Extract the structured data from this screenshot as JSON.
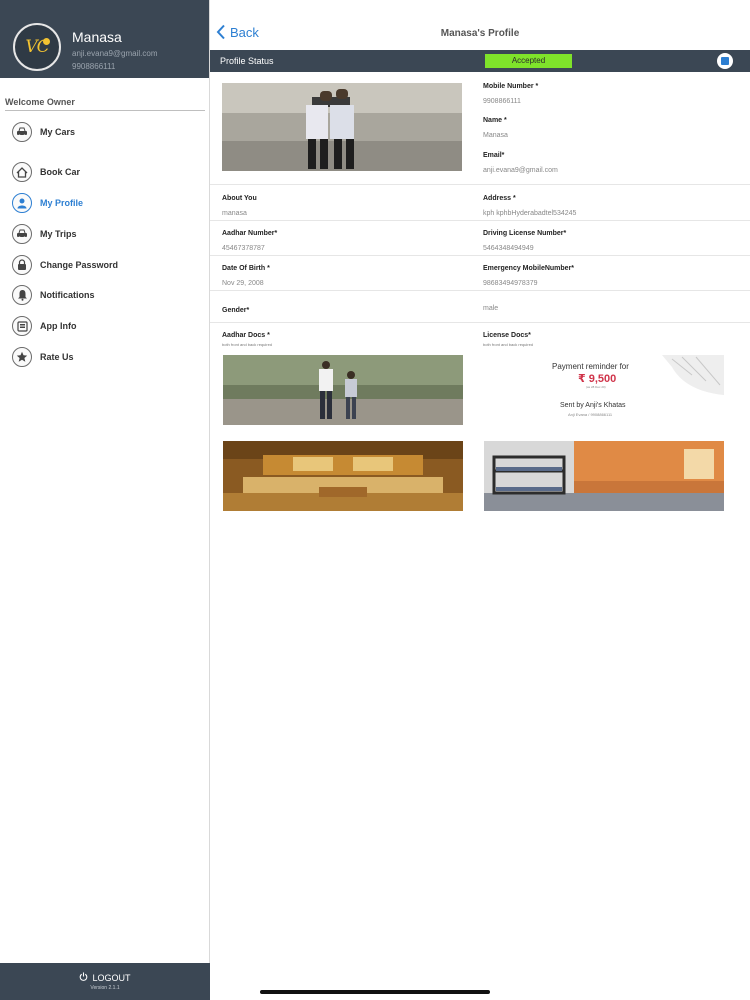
{
  "sidebar": {
    "logo_text": "VC",
    "user_name": "Manasa",
    "user_email": "anji.evana9@gmail.com",
    "user_phone": "9908866111",
    "welcome": "Welcome Owner",
    "items": [
      {
        "label": "My Cars",
        "icon": "car-icon"
      },
      {
        "label": "Book Car",
        "icon": "home-icon"
      },
      {
        "label": "My Profile",
        "icon": "person-icon",
        "active": true
      },
      {
        "label": "My Trips",
        "icon": "car-icon"
      },
      {
        "label": "Change Password",
        "icon": "lock-icon"
      },
      {
        "label": "Notifications",
        "icon": "bell-icon"
      },
      {
        "label": "App Info",
        "icon": "info-icon"
      },
      {
        "label": "Rate Us",
        "icon": "star-icon"
      }
    ],
    "logout": "LOGOUT",
    "version": "Version 2.1.1"
  },
  "header": {
    "back": "Back",
    "title": "Manasa's Profile"
  },
  "status": {
    "label": "Profile Status",
    "value": "Accepted"
  },
  "profile": {
    "mobile_label": "Mobile Number *",
    "mobile_value": "9908866111",
    "name_label": "Name *",
    "name_value": "Manasa",
    "email_label": "Email*",
    "email_value": "anji.evana9@gmail.com",
    "about_label": "About You",
    "about_value": "manasa",
    "address_label": "Address *",
    "address_value": "kph kphbHyderabadtel534245",
    "aadhar_label": "Aadhar Number*",
    "aadhar_value": "45467378787",
    "license_label": "Driving License Number*",
    "license_value": "5464348494949",
    "dob_label": "Date Of Birth *",
    "dob_value": "Nov 29, 2008",
    "emergency_label": "Emergency MobileNumber*",
    "emergency_value": "98683494978379",
    "gender_label": "Gender*",
    "gender_value": "male",
    "aadhar_docs_label": "Aadhar Docs *",
    "aadhar_docs_note": "both front and back required",
    "license_docs_label": "License Docs*",
    "license_docs_note": "both front and back required"
  },
  "license_doc_image": {
    "heading": "Payment reminder for",
    "amount": "₹ 9,500",
    "sub": "(as 28 Dec 20)",
    "sent_by": "Sent by Anji's Khatas",
    "footer": "Anji Evana / 9908866111"
  },
  "colors": {
    "sidebar_bg": "#3b4754",
    "accent": "#2d7fd2",
    "status_badge": "#7fe32a"
  }
}
